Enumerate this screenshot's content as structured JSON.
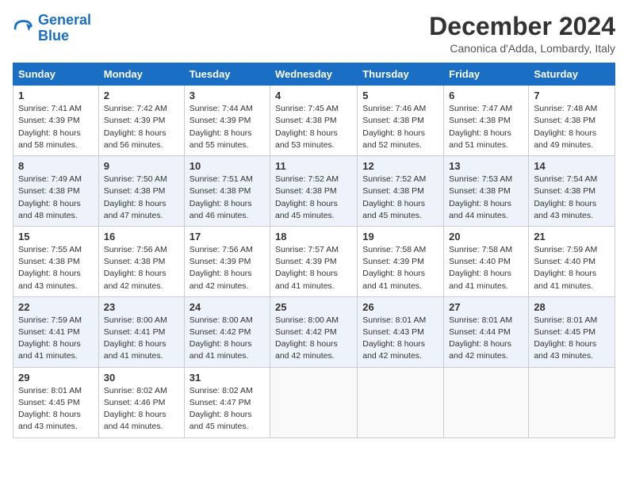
{
  "header": {
    "logo_line1": "General",
    "logo_line2": "Blue",
    "title": "December 2024",
    "subtitle": "Canonica d'Adda, Lombardy, Italy"
  },
  "weekdays": [
    "Sunday",
    "Monday",
    "Tuesday",
    "Wednesday",
    "Thursday",
    "Friday",
    "Saturday"
  ],
  "weeks": [
    [
      {
        "day": "1",
        "sunrise": "7:41 AM",
        "sunset": "4:39 PM",
        "daylight": "8 hours and 58 minutes."
      },
      {
        "day": "2",
        "sunrise": "7:42 AM",
        "sunset": "4:39 PM",
        "daylight": "8 hours and 56 minutes."
      },
      {
        "day": "3",
        "sunrise": "7:44 AM",
        "sunset": "4:39 PM",
        "daylight": "8 hours and 55 minutes."
      },
      {
        "day": "4",
        "sunrise": "7:45 AM",
        "sunset": "4:38 PM",
        "daylight": "8 hours and 53 minutes."
      },
      {
        "day": "5",
        "sunrise": "7:46 AM",
        "sunset": "4:38 PM",
        "daylight": "8 hours and 52 minutes."
      },
      {
        "day": "6",
        "sunrise": "7:47 AM",
        "sunset": "4:38 PM",
        "daylight": "8 hours and 51 minutes."
      },
      {
        "day": "7",
        "sunrise": "7:48 AM",
        "sunset": "4:38 PM",
        "daylight": "8 hours and 49 minutes."
      }
    ],
    [
      {
        "day": "8",
        "sunrise": "7:49 AM",
        "sunset": "4:38 PM",
        "daylight": "8 hours and 48 minutes."
      },
      {
        "day": "9",
        "sunrise": "7:50 AM",
        "sunset": "4:38 PM",
        "daylight": "8 hours and 47 minutes."
      },
      {
        "day": "10",
        "sunrise": "7:51 AM",
        "sunset": "4:38 PM",
        "daylight": "8 hours and 46 minutes."
      },
      {
        "day": "11",
        "sunrise": "7:52 AM",
        "sunset": "4:38 PM",
        "daylight": "8 hours and 45 minutes."
      },
      {
        "day": "12",
        "sunrise": "7:52 AM",
        "sunset": "4:38 PM",
        "daylight": "8 hours and 45 minutes."
      },
      {
        "day": "13",
        "sunrise": "7:53 AM",
        "sunset": "4:38 PM",
        "daylight": "8 hours and 44 minutes."
      },
      {
        "day": "14",
        "sunrise": "7:54 AM",
        "sunset": "4:38 PM",
        "daylight": "8 hours and 43 minutes."
      }
    ],
    [
      {
        "day": "15",
        "sunrise": "7:55 AM",
        "sunset": "4:38 PM",
        "daylight": "8 hours and 43 minutes."
      },
      {
        "day": "16",
        "sunrise": "7:56 AM",
        "sunset": "4:38 PM",
        "daylight": "8 hours and 42 minutes."
      },
      {
        "day": "17",
        "sunrise": "7:56 AM",
        "sunset": "4:39 PM",
        "daylight": "8 hours and 42 minutes."
      },
      {
        "day": "18",
        "sunrise": "7:57 AM",
        "sunset": "4:39 PM",
        "daylight": "8 hours and 41 minutes."
      },
      {
        "day": "19",
        "sunrise": "7:58 AM",
        "sunset": "4:39 PM",
        "daylight": "8 hours and 41 minutes."
      },
      {
        "day": "20",
        "sunrise": "7:58 AM",
        "sunset": "4:40 PM",
        "daylight": "8 hours and 41 minutes."
      },
      {
        "day": "21",
        "sunrise": "7:59 AM",
        "sunset": "4:40 PM",
        "daylight": "8 hours and 41 minutes."
      }
    ],
    [
      {
        "day": "22",
        "sunrise": "7:59 AM",
        "sunset": "4:41 PM",
        "daylight": "8 hours and 41 minutes."
      },
      {
        "day": "23",
        "sunrise": "8:00 AM",
        "sunset": "4:41 PM",
        "daylight": "8 hours and 41 minutes."
      },
      {
        "day": "24",
        "sunrise": "8:00 AM",
        "sunset": "4:42 PM",
        "daylight": "8 hours and 41 minutes."
      },
      {
        "day": "25",
        "sunrise": "8:00 AM",
        "sunset": "4:42 PM",
        "daylight": "8 hours and 42 minutes."
      },
      {
        "day": "26",
        "sunrise": "8:01 AM",
        "sunset": "4:43 PM",
        "daylight": "8 hours and 42 minutes."
      },
      {
        "day": "27",
        "sunrise": "8:01 AM",
        "sunset": "4:44 PM",
        "daylight": "8 hours and 42 minutes."
      },
      {
        "day": "28",
        "sunrise": "8:01 AM",
        "sunset": "4:45 PM",
        "daylight": "8 hours and 43 minutes."
      }
    ],
    [
      {
        "day": "29",
        "sunrise": "8:01 AM",
        "sunset": "4:45 PM",
        "daylight": "8 hours and 43 minutes."
      },
      {
        "day": "30",
        "sunrise": "8:02 AM",
        "sunset": "4:46 PM",
        "daylight": "8 hours and 44 minutes."
      },
      {
        "day": "31",
        "sunrise": "8:02 AM",
        "sunset": "4:47 PM",
        "daylight": "8 hours and 45 minutes."
      },
      null,
      null,
      null,
      null
    ]
  ],
  "labels": {
    "sunrise": "Sunrise:",
    "sunset": "Sunset:",
    "daylight": "Daylight:"
  }
}
